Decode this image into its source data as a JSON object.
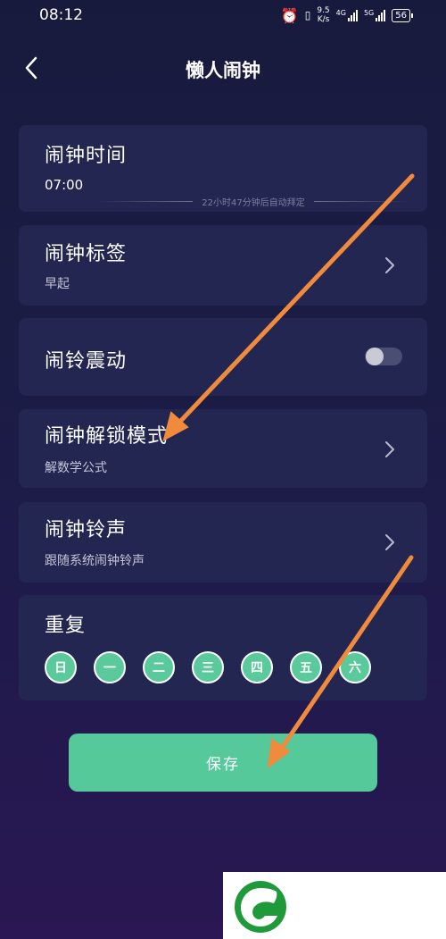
{
  "status_bar": {
    "time": "08:12",
    "speed_value": "9.5",
    "speed_unit": "K/s",
    "net_1": "4G",
    "net_2": "5G",
    "battery": "56",
    "icons": [
      "alarm-icon",
      "vibrate-icon",
      "signal-icon",
      "battery-icon"
    ]
  },
  "header": {
    "title": "懒人闹钟"
  },
  "alarm_time": {
    "label": "闹钟时间",
    "value": "07:00",
    "hint": "22小时47分钟后自动拜定"
  },
  "alarm_tag": {
    "label": "闹钟标签",
    "value": "早起"
  },
  "vibration": {
    "label": "闹铃震动",
    "enabled": false
  },
  "unlock_mode": {
    "label": "闹钟解锁模式",
    "value": "解数学公式"
  },
  "ringtone": {
    "label": "闹钟铃声",
    "value": "跟随系统闹钟铃声"
  },
  "repeat": {
    "label": "重复",
    "days": [
      "日",
      "一",
      "二",
      "三",
      "四",
      "五",
      "六"
    ]
  },
  "save_label": "保存",
  "colors": {
    "accent": "#55c99a",
    "card": "#222651",
    "arrow": "#f08a3c"
  }
}
